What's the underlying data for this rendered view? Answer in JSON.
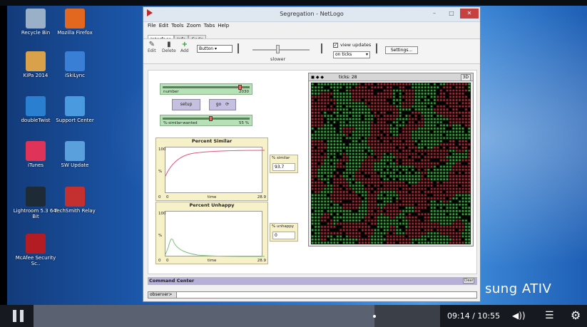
{
  "desktop": {
    "icons": [
      {
        "label": "Recycle Bin",
        "color": "#9ab0c8"
      },
      {
        "label": "Mozilla Firefox",
        "color": "#e2671f"
      },
      {
        "label": "KiPa 2014",
        "color": "#d8a14a"
      },
      {
        "label": "iSkiLync",
        "color": "#3a7fd6"
      },
      {
        "label": "doubleTwist",
        "color": "#2b7fd0"
      },
      {
        "label": "Support Center",
        "color": "#4a9ae0"
      },
      {
        "label": "iTunes",
        "color": "#e0335a"
      },
      {
        "label": "SW Update",
        "color": "#5aa0dc"
      },
      {
        "label": "Lightroom 5.3 64-Bit",
        "color": "#1e2a36"
      },
      {
        "label": "TechSmith Relay",
        "color": "#c43030"
      },
      {
        "label": "McAfee Security Sc..",
        "color": "#b41c24"
      }
    ],
    "brand": "sung ATIV"
  },
  "window": {
    "title": "Segregation - NetLogo",
    "menu": [
      "File",
      "Edit",
      "Tools",
      "Zoom",
      "Tabs",
      "Help"
    ],
    "tabs": [
      "Interface",
      "Info",
      "Code"
    ],
    "toolbar": {
      "edit": "Edit",
      "delete": "Delete",
      "add": "Add",
      "widget": "Button",
      "speed": "slower",
      "view_updates": "view updates",
      "update_mode": "on ticks",
      "settings": "Settings..."
    },
    "sliders": [
      {
        "name": "number",
        "value": "2030",
        "fraction": 0.9
      },
      {
        "name": "%-similar-wanted",
        "value": "55 %",
        "fraction": 0.55
      }
    ],
    "buttons": [
      "setup",
      "go"
    ],
    "plot_similar": {
      "title": "Percent Similar",
      "ymax": "100",
      "ymin": "0",
      "ylabel": "%",
      "xmin": "0",
      "xmax": "28.9",
      "xlabel": "time",
      "color": "#e0507a"
    },
    "plot_unhappy": {
      "title": "Percent Unhappy",
      "ymax": "100",
      "ymin": "0",
      "ylabel": "%",
      "xmin": "0",
      "xmax": "28.9",
      "xlabel": "time",
      "color": "#7fbf7f"
    },
    "monitor_similar": {
      "name": "% similar",
      "value": "93.7"
    },
    "monitor_unhappy": {
      "name": "% unhappy",
      "value": "0"
    },
    "world": {
      "ticks": "ticks: 28",
      "badge": "3D"
    },
    "command_center": {
      "title": "Command Center",
      "clear": "Clear",
      "prompt": "observer>"
    }
  },
  "player": {
    "time": "09:14 / 10:55",
    "progress": 0.839
  }
}
